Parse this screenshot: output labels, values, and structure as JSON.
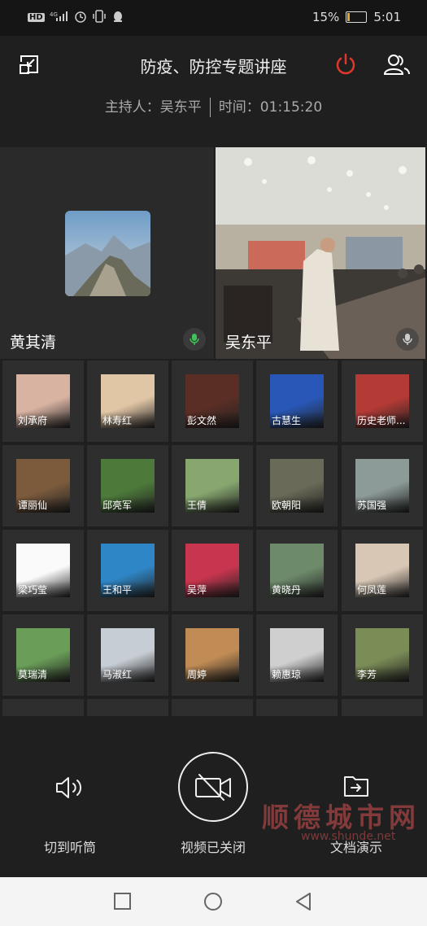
{
  "status_bar": {
    "network_badges": [
      "HD",
      "4G"
    ],
    "battery": "15%",
    "battery_level": 0.15,
    "time": "5:01"
  },
  "header": {
    "title": "防疫、防控专题讲座",
    "host": "主持人：吴东平",
    "duration": "时间：01:15:20"
  },
  "main_videos": [
    {
      "name": "黄其清"
    },
    {
      "name": "吴东平"
    }
  ],
  "participants": [
    {
      "name": "刘承府",
      "color": "#d8b3a2"
    },
    {
      "name": "林寿红",
      "color": "#e1c6a6"
    },
    {
      "name": "彭文然",
      "color": "#5a2e25"
    },
    {
      "name": "古慧生",
      "color": "#2857b7"
    },
    {
      "name": "历史老师...",
      "color": "#b33a35"
    },
    {
      "name": "谭丽仙",
      "color": "#7c5b3d"
    },
    {
      "name": "邱亮军",
      "color": "#4d7a3a"
    },
    {
      "name": "王倩",
      "color": "#87a76f"
    },
    {
      "name": "欧朝阳",
      "color": "#6a6a58"
    },
    {
      "name": "苏国强",
      "color": "#8c9a98"
    },
    {
      "name": "梁巧莹",
      "color": "#fafafa"
    },
    {
      "name": "王和平",
      "color": "#2f86c6"
    },
    {
      "name": "吴萍",
      "color": "#c8354e"
    },
    {
      "name": "黄晓丹",
      "color": "#6d8a6a"
    },
    {
      "name": "何凤莲",
      "color": "#d8c7b4"
    },
    {
      "name": "莫瑞清",
      "color": "#6a9e58"
    },
    {
      "name": "马淑红",
      "color": "#c7cdd4"
    },
    {
      "name": "周婷",
      "color": "#c08b54"
    },
    {
      "name": "赖惠琼",
      "color": "#cfcfcf"
    },
    {
      "name": "李芳",
      "color": "#7b8d57"
    }
  ],
  "controls": {
    "speaker_label": "切到听筒",
    "camera_label": "视频已关闭",
    "share_label": "文档演示"
  },
  "watermark": {
    "text": "顺德城市网",
    "url": "www.shunde.net"
  }
}
